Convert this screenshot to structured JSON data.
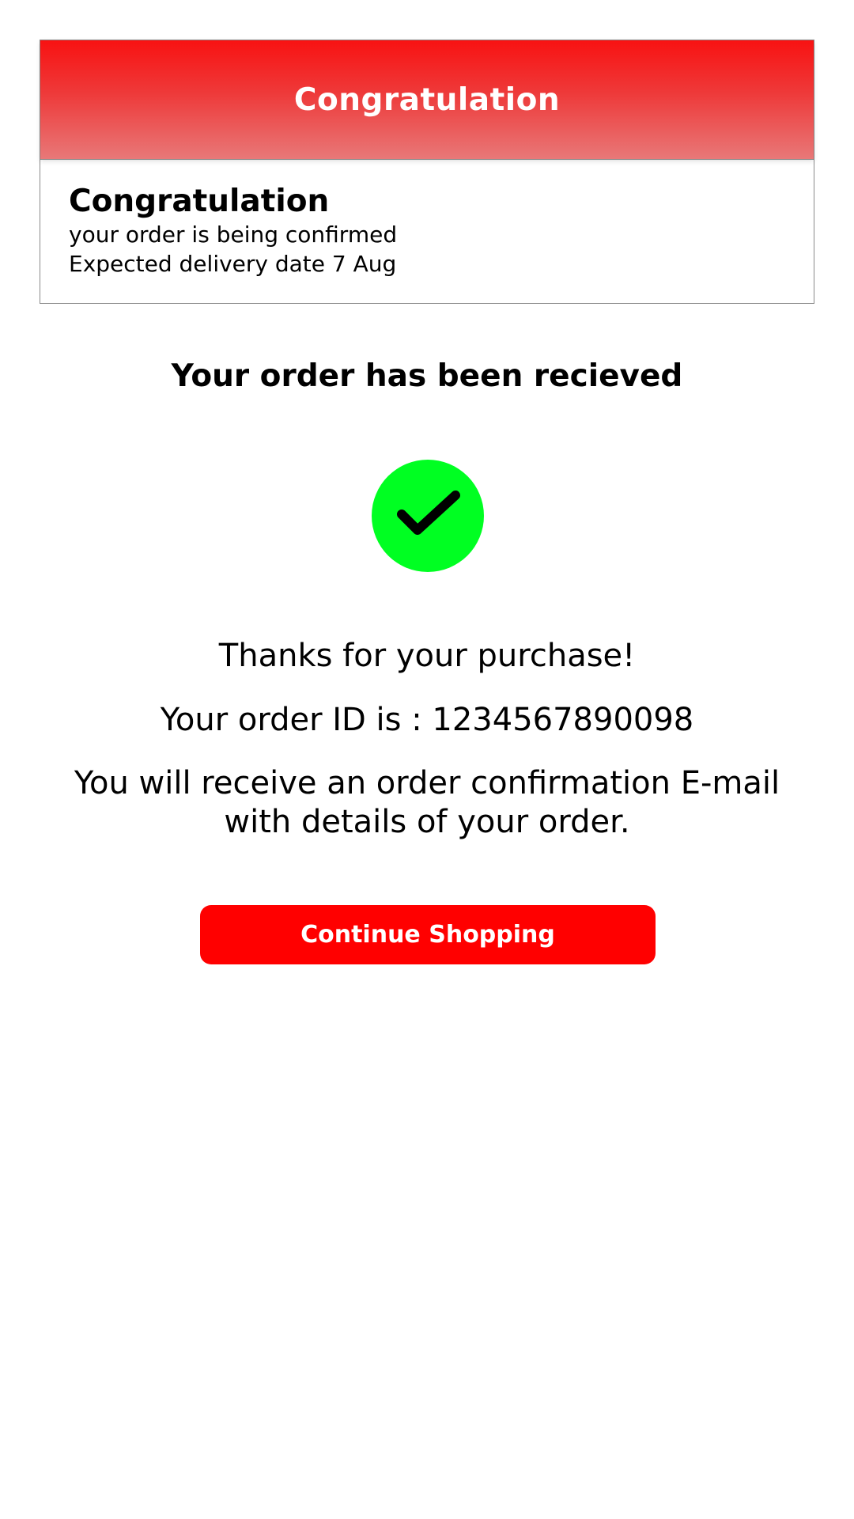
{
  "header": {
    "title": "Congratulation"
  },
  "card": {
    "title": "Congratulation",
    "status_line": "your order is being confirmed",
    "delivery_line": "Expected delivery date 7 Aug"
  },
  "confirmation": {
    "heading": "Your order has been recieved",
    "icon": "check-circle-icon",
    "thanks_text": "Thanks for your purchase!",
    "order_id_text": "Your order ID is : 1234567890098",
    "email_note": "You will receive an order confirmation E-mail with details of your order."
  },
  "actions": {
    "continue_label": "Continue Shopping"
  },
  "colors": {
    "header_red": "#f81212",
    "button_red": "#ff0000",
    "check_green": "#00ff22",
    "text": "#000000"
  }
}
